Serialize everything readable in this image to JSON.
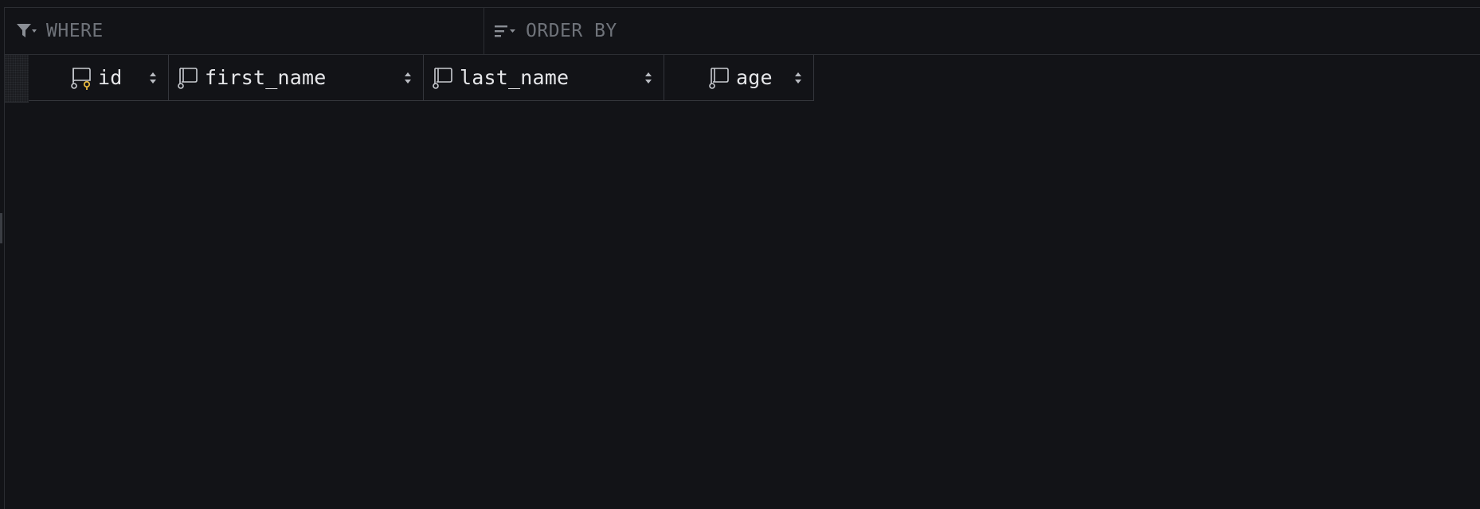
{
  "filters": {
    "where_placeholder": "WHERE",
    "order_by_placeholder": "ORDER BY"
  },
  "columns": [
    {
      "label": "id",
      "icon": "primary-key-column-icon",
      "sortable": true
    },
    {
      "label": "first_name",
      "icon": "column-icon",
      "sortable": true
    },
    {
      "label": "last_name",
      "icon": "column-icon",
      "sortable": true
    },
    {
      "label": "age",
      "icon": "column-icon",
      "sortable": true
    }
  ],
  "colors": {
    "background": "#121317",
    "border": "#2c2e33",
    "placeholder": "#6f737a",
    "header_text": "#e6e7ea",
    "key_accent": "#e5b83f"
  }
}
